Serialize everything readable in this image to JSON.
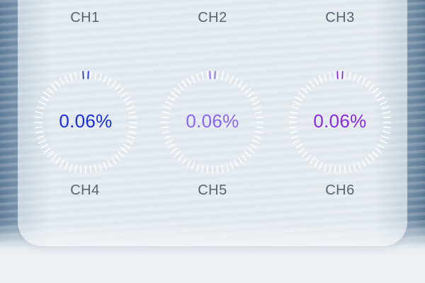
{
  "channels_top": [
    {
      "label": "CH1"
    },
    {
      "label": "CH2"
    },
    {
      "label": "CH3"
    }
  ],
  "channels": [
    {
      "label": "CH4",
      "value_text": "0.06%",
      "value": 0.06,
      "color": "#1a2fd6"
    },
    {
      "label": "CH5",
      "value_text": "0.06%",
      "value": 0.06,
      "color": "#8a66ee"
    },
    {
      "label": "CH6",
      "value_text": "0.06%",
      "value": 0.06,
      "color": "#8a2be2"
    }
  ]
}
